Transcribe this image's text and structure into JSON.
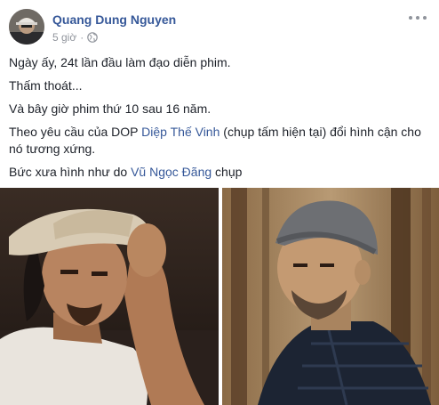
{
  "post": {
    "author": "Quang Dung Nguyen",
    "time": "5 giờ",
    "separator": "·",
    "privacy_icon": "globe-icon",
    "more_icon": "ellipsis-icon",
    "lines": {
      "line1": "Ngày ấy, 24t lần đầu làm đạo diễn phim.",
      "line2": "Thấm thoát...",
      "line3": "Và bây giờ phim thứ 10 sau 16 năm.",
      "line4_before": "Theo yêu cầu của DOP ",
      "line4_link": "Diệp Thế Vinh",
      "line4_after": " (chụp tấm hiện tại) đổi hình cận cho nó tương xứng.",
      "line5_before": "Bức xưa hình như do ",
      "line5_link": "Vũ Ngọc Đãng",
      "line5_after": " chụp"
    },
    "photos": [
      {
        "alt": "old-portrait-photo"
      },
      {
        "alt": "recent-portrait-photo"
      }
    ]
  },
  "colors": {
    "link": "#365899",
    "text": "#1d2129",
    "meta": "#90949c"
  }
}
